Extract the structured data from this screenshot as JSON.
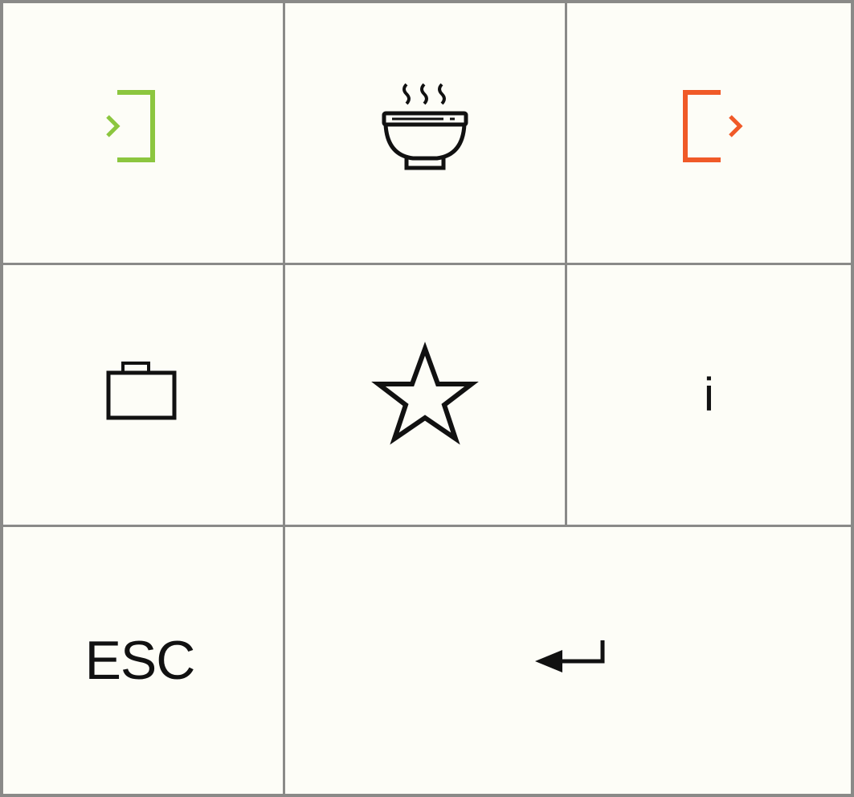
{
  "keypad": {
    "keys": [
      {
        "id": "check-in",
        "icon": "enter-icon",
        "color": "#8cc63f"
      },
      {
        "id": "break",
        "icon": "soup-bowl-icon",
        "color": "#000000"
      },
      {
        "id": "check-out",
        "icon": "exit-icon",
        "color": "#f05a28"
      },
      {
        "id": "business",
        "icon": "briefcase-icon",
        "color": "#000000"
      },
      {
        "id": "favorite",
        "icon": "star-icon",
        "color": "#000000"
      },
      {
        "id": "info",
        "label": "i"
      },
      {
        "id": "escape",
        "label": "ESC"
      },
      {
        "id": "enter",
        "icon": "return-arrow-icon",
        "color": "#000000"
      }
    ]
  },
  "colors": {
    "background": "#fdfdf7",
    "grid_lines": "#8a8a88",
    "check_in_accent": "#8cc63f",
    "check_out_accent": "#f05a28"
  }
}
